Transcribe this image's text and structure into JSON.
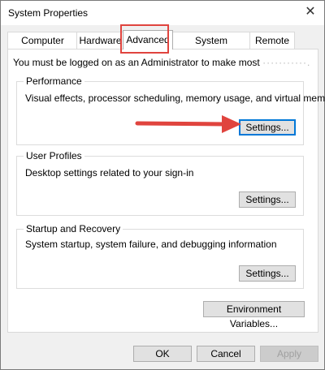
{
  "window": {
    "title": "System Properties",
    "close_glyph": "✕"
  },
  "tabs": [
    {
      "label": "Computer Name"
    },
    {
      "label": "Hardware"
    },
    {
      "label": "Advanced"
    },
    {
      "label": "System Protection"
    },
    {
      "label": "Remote"
    }
  ],
  "active_tab": "Advanced",
  "admin_note": {
    "text": "You must be logged on as an Administrator to make most",
    "blurred_suffix": "···········."
  },
  "performance": {
    "title": "Performance",
    "description": "Visual effects, processor scheduling, memory usage, and virtual memory",
    "settings_label": "Settings..."
  },
  "user_profiles": {
    "title": "User Profiles",
    "description": "Desktop settings related to your sign-in",
    "settings_label": "Settings..."
  },
  "startup_recovery": {
    "title": "Startup and Recovery",
    "description": "System startup, system failure, and debugging information",
    "settings_label": "Settings..."
  },
  "env_button": "Environment Variables...",
  "footer": {
    "ok": "OK",
    "cancel": "Cancel",
    "apply": "Apply"
  },
  "colors": {
    "annotation": "#e0443e",
    "focus": "#0078d7"
  },
  "icons": {
    "close": "close-icon",
    "arrow": "arrow-annotation"
  }
}
